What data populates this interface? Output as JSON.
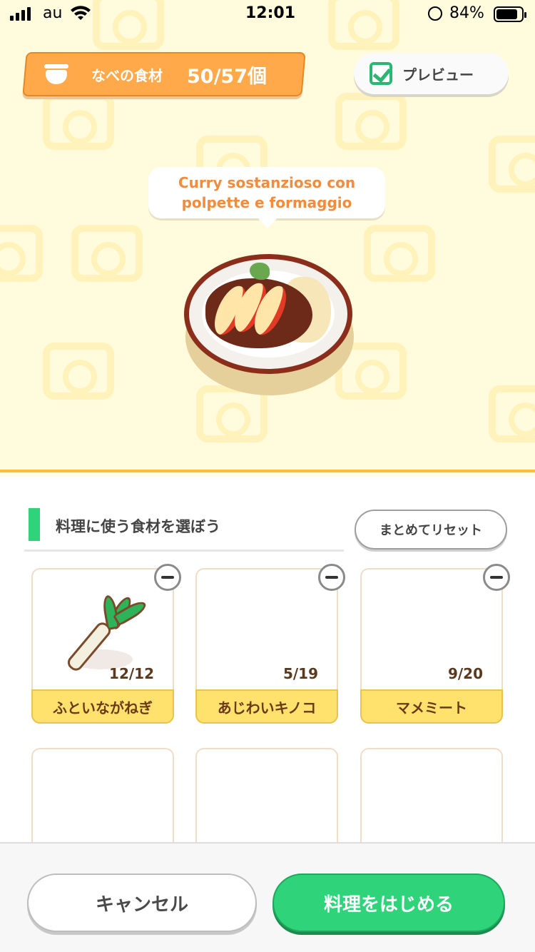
{
  "status_bar": {
    "carrier": "au",
    "time": "12:01",
    "battery_percent_text": "84%",
    "battery_level": 0.84
  },
  "pot": {
    "label": "なべの食材",
    "count": "50/57個"
  },
  "preview": {
    "label": "プレビュー",
    "checked": true
  },
  "recipe": {
    "name_line1": "Curry sostanzioso con",
    "name_line2": "polpette e formaggio"
  },
  "section": {
    "title": "料理に使う食材を選ぼう",
    "reset_label": "まとめてリセット"
  },
  "ingredients": [
    {
      "name": "ふといながねぎ",
      "count": "12/12"
    },
    {
      "name": "あじわいキノコ",
      "count": "5/19"
    },
    {
      "name": "マメミート",
      "count": "9/20"
    }
  ],
  "footer": {
    "cancel_label": "キャンセル",
    "start_label": "料理をはじめる"
  },
  "colors": {
    "accent_green": "#2ed37a",
    "pot_orange": "#ffa94a",
    "label_yellow": "#ffe16e",
    "recipe_text": "#f08c3c"
  }
}
